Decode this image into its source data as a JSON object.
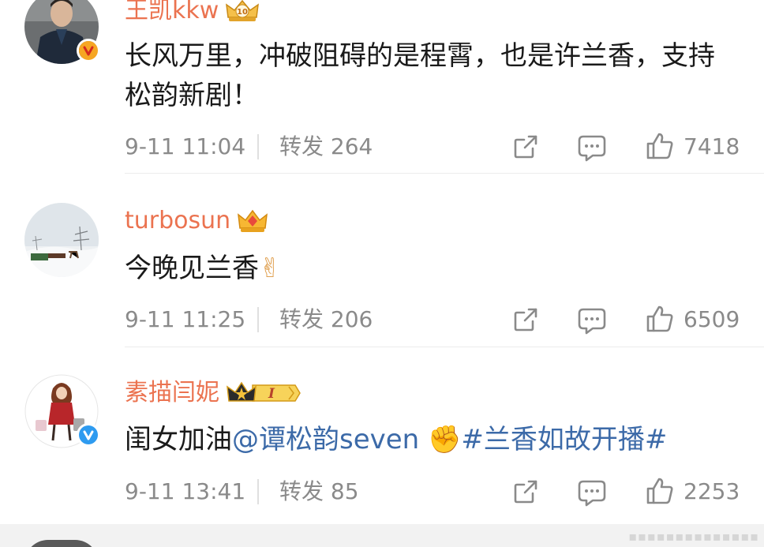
{
  "comments": [
    {
      "username": "王凯kkw",
      "content": "长风万里，冲破阻碍的是程霄，也是许兰香，支持松韵新剧！",
      "time": "9-11 11:04",
      "repost": "转发 264",
      "likes": "7418"
    },
    {
      "username": "turbosun",
      "content": "今晚见兰香",
      "emoji": "✌",
      "time": "9-11 11:25",
      "repost": "转发 206",
      "likes": "6509"
    },
    {
      "username": "素描闫妮",
      "content_prefix": "闺女加油",
      "mention": "@谭松韵seven",
      "emoji": "✊",
      "topic": "#兰香如故开播#",
      "time": "9-11 13:41",
      "repost": "转发 85",
      "likes": "2253"
    }
  ],
  "badges": {
    "level_1": "10",
    "vip_3": "I"
  },
  "colors": {
    "username": "#eb7350",
    "link": "#3c6aa8",
    "meta": "#8a8a8a",
    "verified_orange": "#f6a623",
    "verified_blue": "#2e9bf0"
  },
  "icons": [
    "share-icon",
    "comment-icon",
    "like-icon",
    "verified-orange-icon",
    "verified-blue-icon",
    "crown-icon"
  ]
}
